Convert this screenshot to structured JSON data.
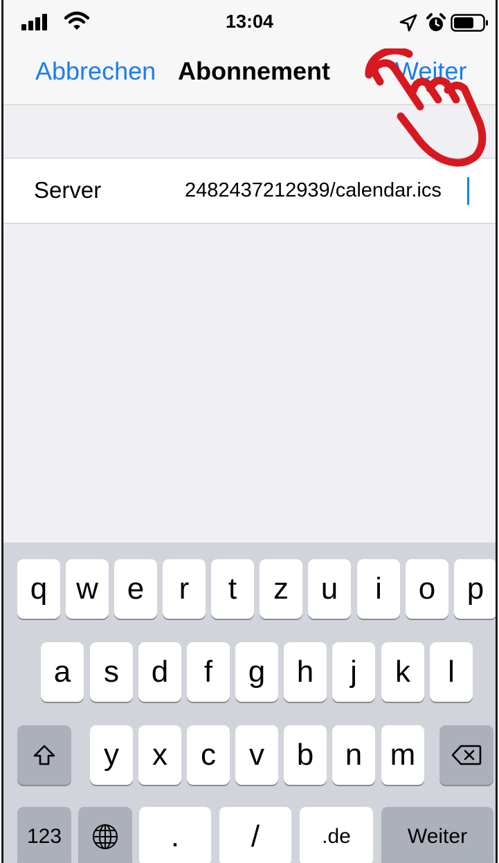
{
  "status_bar": {
    "time": "13:04"
  },
  "nav": {
    "cancel_label": "Abbrechen",
    "title": "Abonnement",
    "next_label": "Weiter"
  },
  "form": {
    "server_label": "Server",
    "server_value": "2482437212939/calendar.ics"
  },
  "keyboard": {
    "row1": [
      "q",
      "w",
      "e",
      "r",
      "t",
      "z",
      "u",
      "i",
      "o",
      "p"
    ],
    "row2": [
      "a",
      "s",
      "d",
      "f",
      "g",
      "h",
      "j",
      "k",
      "l"
    ],
    "row3": [
      "y",
      "x",
      "c",
      "v",
      "b",
      "n",
      "m"
    ],
    "numbers_label": "123",
    "dot_label": ".",
    "slash_label": "/",
    "domain_label": ".de",
    "return_label": "Weiter"
  },
  "colors": {
    "accent": "#1b7cf2",
    "annotation": "#d7191f"
  },
  "icons": [
    "signal-icon",
    "wifi-icon",
    "location-icon",
    "alarm-icon",
    "battery-icon",
    "shift-icon",
    "delete-icon",
    "globe-icon",
    "pointing-hand-icon"
  ]
}
